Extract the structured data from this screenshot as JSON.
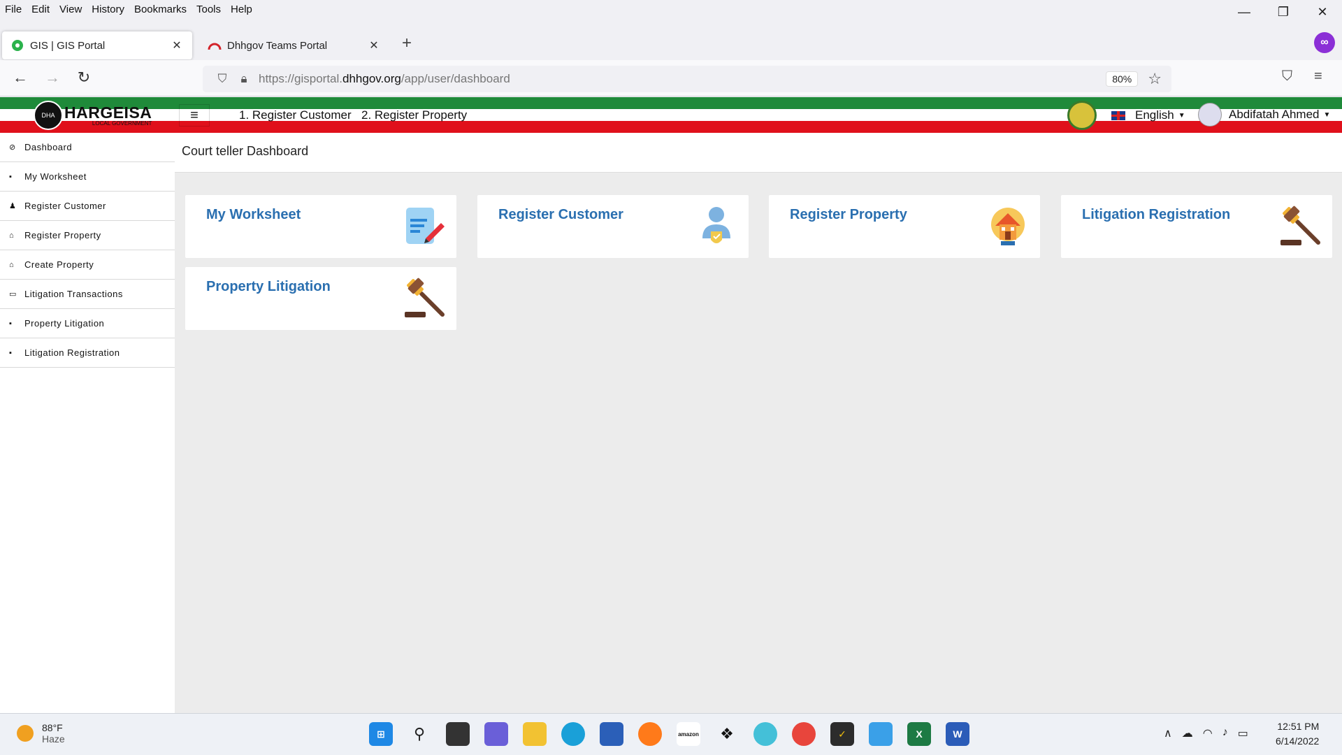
{
  "menubar": {
    "items": [
      {
        "u": "F",
        "rest": "ile"
      },
      {
        "u": "E",
        "rest": "dit"
      },
      {
        "u": "V",
        "rest": "iew"
      },
      {
        "u": "",
        "pre": "Hi",
        "u2": "s",
        "rest": "tory"
      },
      {
        "u": "B",
        "rest": "ookmarks"
      },
      {
        "u": "T",
        "rest": "ools"
      },
      {
        "u": "H",
        "rest": "elp"
      }
    ],
    "labels": [
      "File",
      "Edit",
      "View",
      "History",
      "Bookmarks",
      "Tools",
      "Help"
    ]
  },
  "window_controls": {
    "minimize": "—",
    "restore": "❐",
    "close": "✕"
  },
  "tabs": [
    {
      "title": "GIS | GIS Portal",
      "close": "✕",
      "icon": "gis-favicon",
      "icon_color": "#2bb24c"
    },
    {
      "title": "Dhhgov Teams Portal",
      "close": "✕",
      "icon": "teams-favicon",
      "icon_color": "#d3242b"
    }
  ],
  "new_tab": "+",
  "extension_icon": "∞",
  "nav": {
    "back": "←",
    "forward": "→",
    "reload": "↻"
  },
  "url": {
    "prefix": "https://gisportal.",
    "domain": "dhhgov.org",
    "path": "/app/user/dashboard"
  },
  "zoom": "80%",
  "bookmark_star": "☆",
  "pocket": "⛉",
  "app_menu": "≡",
  "app": {
    "logo_title": "HARGEISA",
    "logo_sub": "LOCAL GOVERNMENT",
    "logo_emblem": "DHA",
    "hamburger": "≡",
    "shortcuts": [
      "1. Register Customer",
      "2. Register Property"
    ],
    "language": "English",
    "user": "Abdifatah Ahmed",
    "flag_colors": {
      "green": "#1f8a3a",
      "white": "#ffffff",
      "red": "#e0101b"
    }
  },
  "sidebar": {
    "items": [
      {
        "label": "Dashboard",
        "icon": "dashboard-icon",
        "glyph": "⊘"
      },
      {
        "label": "My Worksheet",
        "icon": "book-icon",
        "glyph": "▪"
      },
      {
        "label": "Register Customer",
        "icon": "user-icon",
        "glyph": "♟"
      },
      {
        "label": "Register Property",
        "icon": "home-icon",
        "glyph": "⌂"
      },
      {
        "label": "Create Property",
        "icon": "home-icon",
        "glyph": "⌂"
      },
      {
        "label": "Litigation Transactions",
        "icon": "list-icon",
        "glyph": "▭"
      },
      {
        "label": "Property Litigation",
        "icon": "book-icon",
        "glyph": "▪"
      },
      {
        "label": "Litigation Registration",
        "icon": "book-icon",
        "glyph": "▪"
      }
    ]
  },
  "page_title": "Court teller Dashboard",
  "cards": [
    {
      "title": "My Worksheet",
      "icon": "worksheet-icon"
    },
    {
      "title": "Register Customer",
      "icon": "customer-icon"
    },
    {
      "title": "Register Property",
      "icon": "property-icon"
    },
    {
      "title": "Litigation Registration",
      "icon": "gavel-icon"
    },
    {
      "title": "Property Litigation",
      "icon": "gavel-icon"
    }
  ],
  "accent_color": "#2a6fb0",
  "taskbar": {
    "weather_temp": "88°F",
    "weather_desc": "Haze",
    "apps": [
      "start",
      "search",
      "task-view",
      "teams-chat",
      "file-explorer",
      "edge",
      "store",
      "firefox",
      "amazon",
      "dropbox",
      "mail",
      "chrome",
      "norton",
      "notepad",
      "excel",
      "word"
    ],
    "time": "12:51 PM",
    "date": "6/14/2022"
  }
}
